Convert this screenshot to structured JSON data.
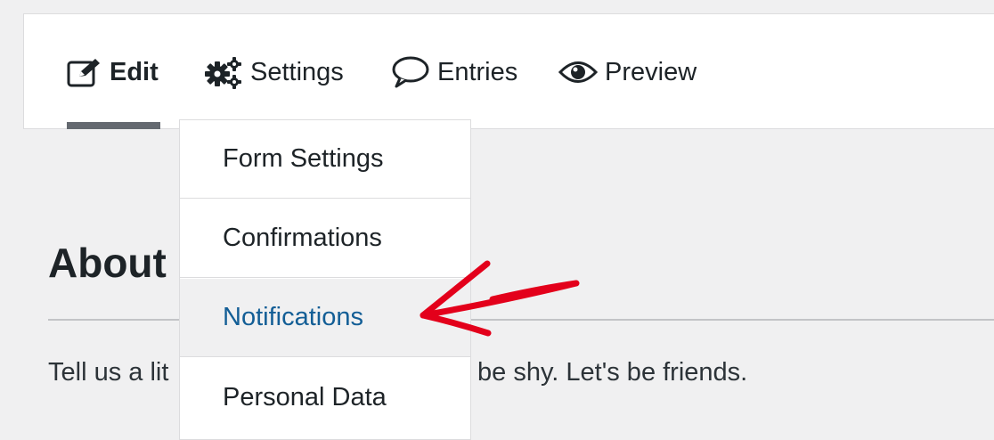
{
  "tabs": [
    {
      "label": "Edit",
      "icon": "edit-icon",
      "active": true
    },
    {
      "label": "Settings",
      "icon": "gears-icon"
    },
    {
      "label": "Entries",
      "icon": "speech-bubble-icon"
    },
    {
      "label": "Preview",
      "icon": "eye-icon"
    }
  ],
  "settings_menu": {
    "items": [
      {
        "label": "Form Settings"
      },
      {
        "label": "Confirmations"
      },
      {
        "label": "Notifications",
        "highlighted": true
      },
      {
        "label": "Personal Data"
      }
    ]
  },
  "content": {
    "title_visible": "About",
    "text_left_visible": "Tell us a lit",
    "text_right_visible": "be shy. Let's be friends."
  },
  "colors": {
    "accent": "#135e96",
    "annotation_arrow": "#e3001b",
    "active_underline": "#646970",
    "background": "#f0f0f1"
  }
}
